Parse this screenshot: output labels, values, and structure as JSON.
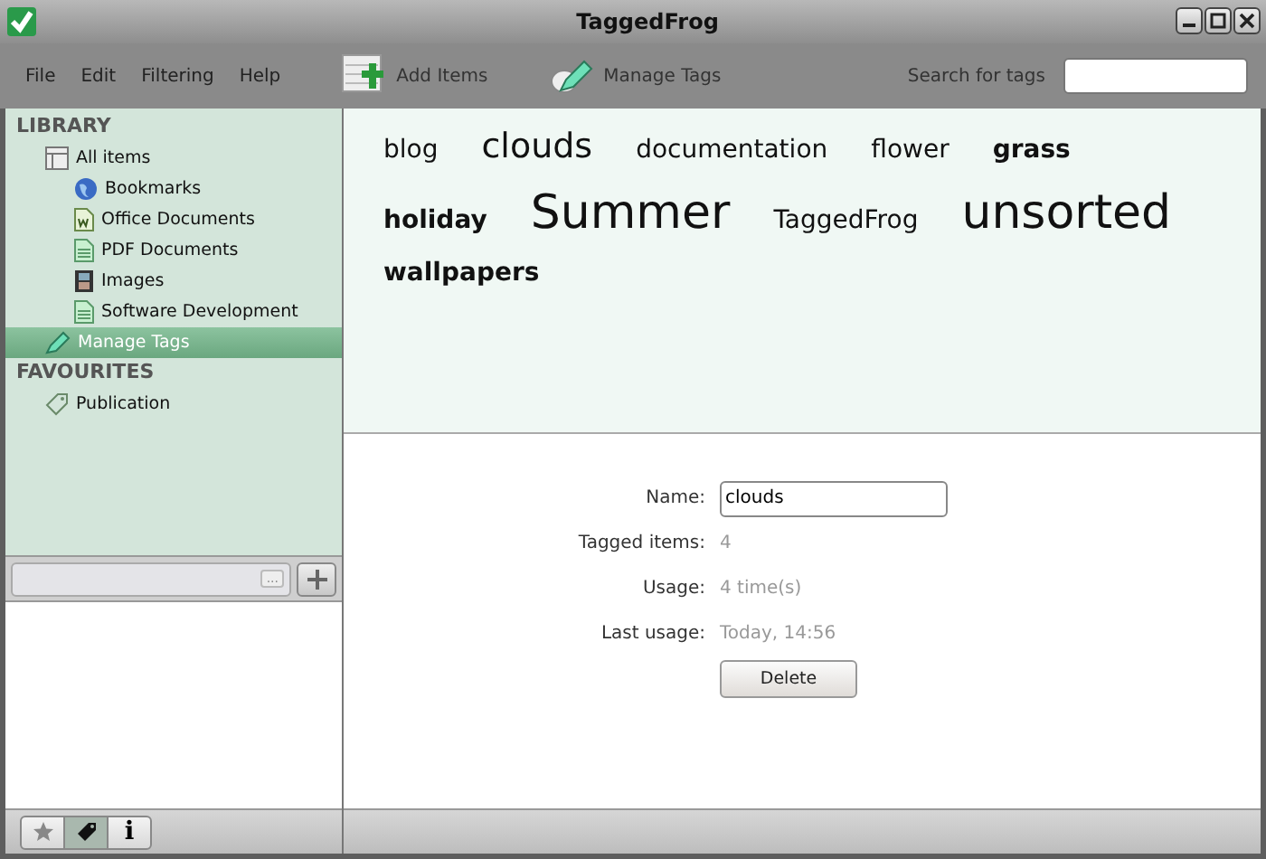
{
  "window": {
    "title": "TaggedFrog"
  },
  "menu": [
    "File",
    "Edit",
    "Filtering",
    "Help"
  ],
  "toolbar": [
    {
      "kind": "add",
      "label": "Add Items"
    },
    {
      "kind": "tags",
      "label": "Manage Tags"
    }
  ],
  "search": {
    "label": "Search for tags"
  },
  "sidebar": {
    "sections": [
      {
        "title": "LIBRARY",
        "items": [
          {
            "kind": "list",
            "label": "All items",
            "selected": false,
            "children": [
              {
                "kind": "globe",
                "label": "Bookmarks",
                "selected": false
              },
              {
                "kind": "word",
                "label": "Office Documents",
                "selected": false
              },
              {
                "kind": "doc",
                "label": "PDF Documents",
                "selected": false
              },
              {
                "kind": "film",
                "label": "Images",
                "selected": false
              },
              {
                "kind": "doc",
                "label": "Software Development",
                "selected": false
              }
            ]
          },
          {
            "kind": "pen",
            "label": "Manage Tags",
            "selected": true
          }
        ]
      },
      {
        "title": "FAVOURITES",
        "items": [
          {
            "kind": "tag",
            "label": "Publication",
            "selected": false
          }
        ]
      }
    ]
  },
  "filter_field": {
    "button": "..."
  },
  "bottom_tabs": [
    {
      "kind": "star",
      "selected": false
    },
    {
      "kind": "tag",
      "selected": true
    },
    {
      "kind": "info",
      "label": "i",
      "selected": false
    }
  ],
  "tag_cloud": [
    [
      {
        "label": "blog",
        "kind": "small",
        "bold": false
      },
      {
        "label": "clouds",
        "kind": "medium",
        "bold": false
      },
      {
        "label": "documentation",
        "kind": "small",
        "bold": false
      },
      {
        "label": "flower",
        "kind": "small",
        "bold": false
      },
      {
        "label": "grass",
        "kind": "small",
        "bold": true
      }
    ],
    [
      {
        "label": "holiday",
        "kind": "small",
        "bold": true
      },
      {
        "label": "Summer",
        "kind": "large",
        "bold": false
      },
      {
        "label": "TaggedFrog",
        "kind": "small",
        "bold": false
      },
      {
        "label": "unsorted",
        "kind": "large",
        "bold": false
      }
    ],
    [
      {
        "label": "wallpapers",
        "kind": "small",
        "bold": true
      }
    ]
  ],
  "details": {
    "name_label": "Name:",
    "name_value": "clouds",
    "rows": [
      {
        "label": "Tagged items:",
        "value": "4"
      },
      {
        "label": "Usage:",
        "value": "4 time(s)"
      },
      {
        "label": "Last usage:",
        "value": "Today, 14:56"
      }
    ],
    "button": "Delete"
  }
}
